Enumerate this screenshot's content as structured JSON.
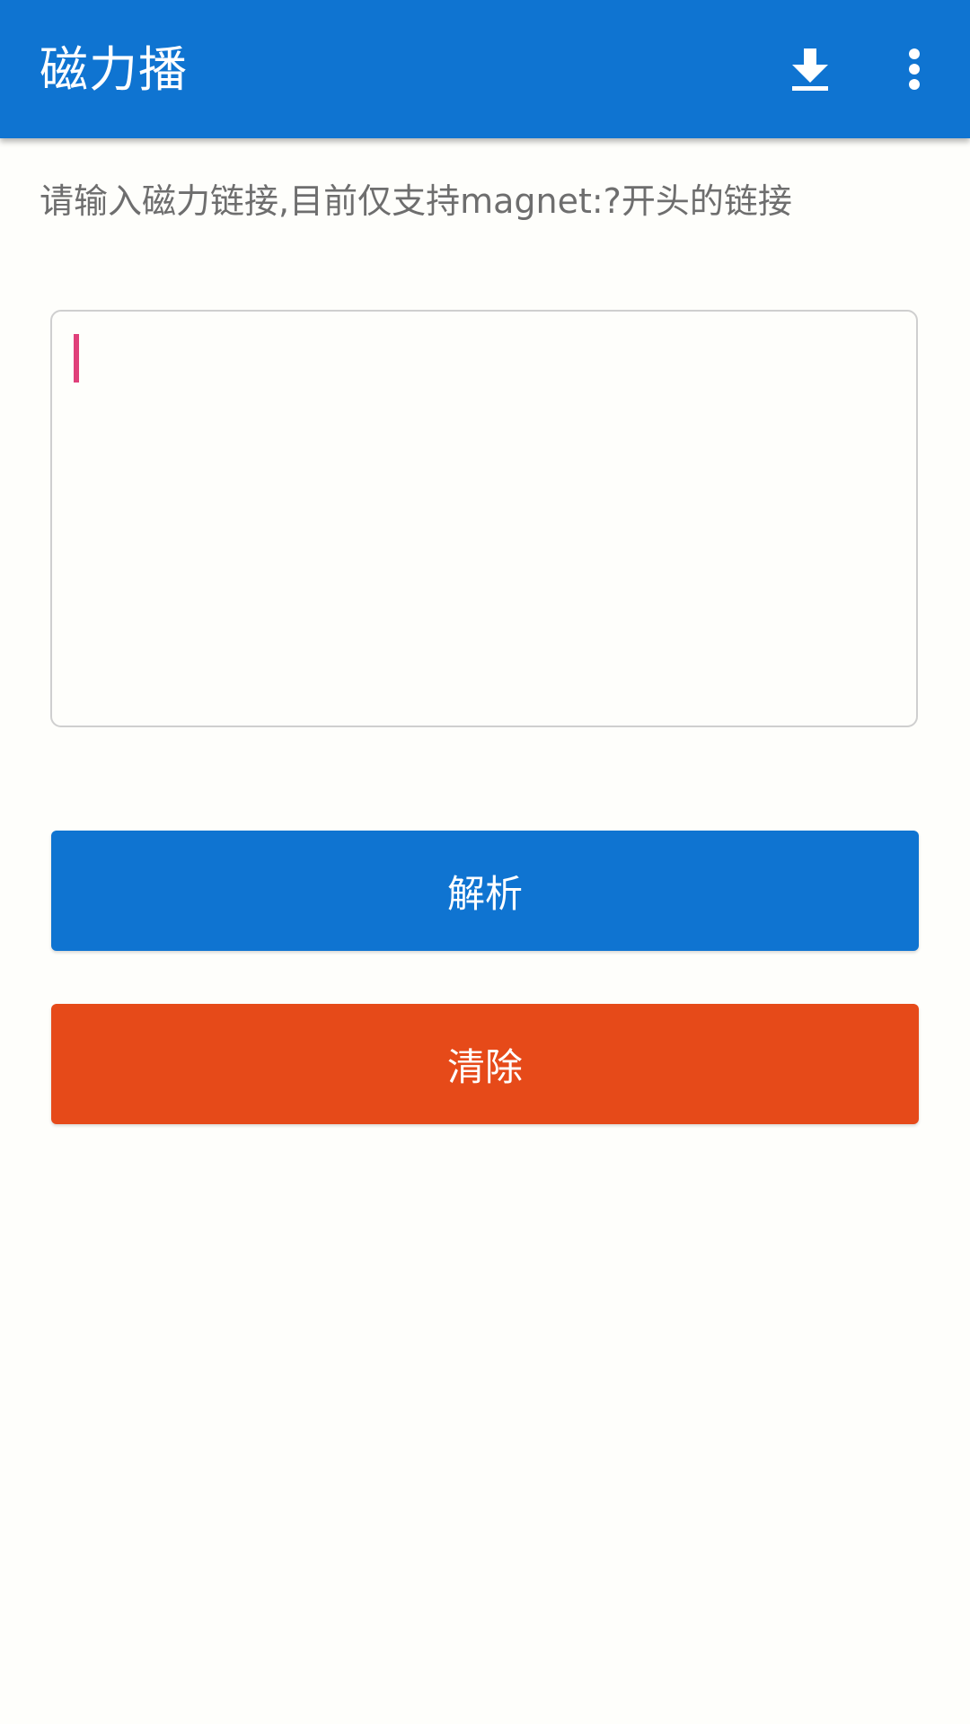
{
  "app_bar": {
    "title": "磁力播",
    "actions": [
      {
        "icon": "download-icon"
      },
      {
        "icon": "more-vert-icon"
      }
    ]
  },
  "hint": "请输入磁力链接,目前仅支持magnet:?开头的链接",
  "magnet_input": {
    "value": "",
    "placeholder": ""
  },
  "buttons": {
    "parse_label": "解析",
    "clear_label": "清除"
  },
  "colors": {
    "primary": "#0f74d1",
    "danger": "#e64a19",
    "caret": "#e0407a",
    "background": "#fefefb"
  }
}
